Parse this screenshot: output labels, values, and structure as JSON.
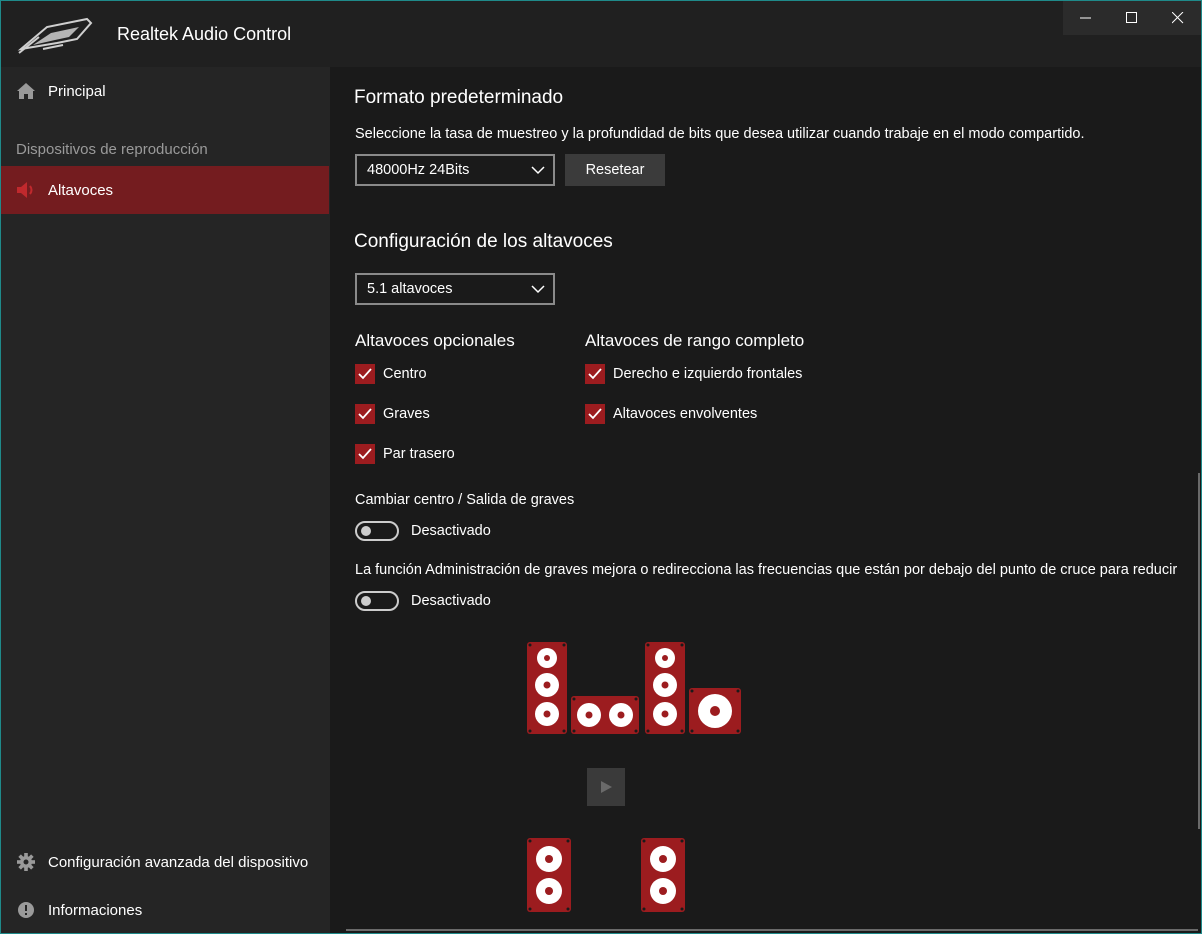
{
  "app": {
    "title": "Realtek Audio Control"
  },
  "window_controls": {
    "minimize_icon": "minimize-icon",
    "maximize_icon": "maximize-icon",
    "close_icon": "close-icon"
  },
  "colors": {
    "accent": "#9c1c1f",
    "active_nav": "#741c1f",
    "sidebar_bg": "#252525",
    "main_bg": "#1a1a1a",
    "titlebar_bg": "#202020"
  },
  "sidebar": {
    "principal": {
      "label": "Principal",
      "icon": "home-icon"
    },
    "section_header": "Dispositivos de reproducción",
    "altavoces": {
      "label": "Altavoces",
      "icon": "speaker-icon"
    },
    "advanced": {
      "label": "Configuración avanzada del dispositivo",
      "icon": "gear-icon"
    },
    "info": {
      "label": "Informaciones",
      "icon": "info-icon"
    }
  },
  "main": {
    "default_format": {
      "title": "Formato predeterminado",
      "description": "Seleccione la tasa de muestreo y la profundidad de bits que desea utilizar cuando trabaje en el modo compartido.",
      "selected": "48000Hz 24Bits",
      "reset_label": "Resetear"
    },
    "speaker_config": {
      "title": "Configuración de los altavoces",
      "selected": "5.1 altavoces"
    },
    "optional_speakers": {
      "title": "Altavoces opcionales",
      "items": [
        {
          "label": "Centro",
          "checked": true
        },
        {
          "label": "Graves",
          "checked": true
        },
        {
          "label": "Par trasero",
          "checked": true
        }
      ]
    },
    "full_range": {
      "title": "Altavoces de rango completo",
      "items": [
        {
          "label": "Derecho e izquierdo frontales",
          "checked": true
        },
        {
          "label": "Altavoces envolventes",
          "checked": true
        }
      ]
    },
    "swap_center": {
      "title": "Cambiar centro / Salida de graves",
      "state": "Desactivado"
    },
    "bass_management": {
      "description": "La función Administración de graves mejora o redirecciona las frecuencias que están por debajo del punto de cruce para reducir",
      "state": "Desactivado"
    },
    "test": {
      "play_icon": "play-icon"
    }
  }
}
